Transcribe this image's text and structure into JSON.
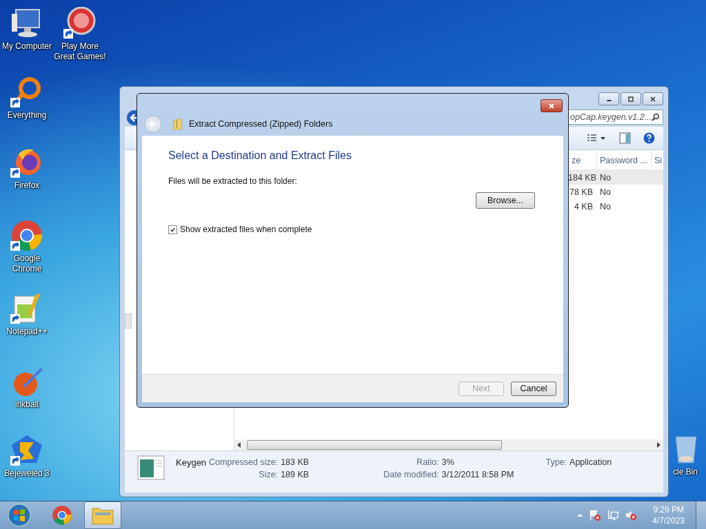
{
  "desktop_icons": [
    {
      "kind": "computer",
      "label": "My Computer",
      "shortcut": false
    },
    {
      "kind": "popcap",
      "label": "Play More Great Games!",
      "shortcut": true
    },
    {
      "kind": "everything",
      "label": "Everything",
      "shortcut": true
    },
    {
      "kind": "firefox",
      "label": "Firefox",
      "shortcut": true
    },
    {
      "kind": "chrome",
      "label": "Google Chrome",
      "shortcut": true
    },
    {
      "kind": "notepad",
      "label": "Notepad++",
      "shortcut": true
    },
    {
      "kind": "inkball",
      "label": "inkball",
      "shortcut": false
    },
    {
      "kind": "bejeweled",
      "label": "Bejeweled 3",
      "shortcut": true
    },
    {
      "kind": "recycle",
      "label": "cle Bin",
      "shortcut": false
    }
  ],
  "explorer": {
    "search": "opCap.keygen.v1.2...",
    "columns": [
      "ze",
      "Password ...",
      "Si"
    ],
    "rows": [
      {
        "cells": [
          "184 KB",
          "No"
        ],
        "selected": true
      },
      {
        "cells": [
          "78 KB",
          "No"
        ],
        "selected": false
      },
      {
        "cells": [
          "4 KB",
          "No"
        ],
        "selected": false
      }
    ],
    "details": {
      "name": "Keygen",
      "fields": [
        {
          "label": "Compressed size:",
          "value": "183 KB"
        },
        {
          "label": "Size:",
          "value": "189 KB"
        },
        {
          "label": "Ratio:",
          "value": "3%"
        },
        {
          "label": "Date modified:",
          "value": "3/12/2011 8:58 PM"
        },
        {
          "label": "Type:",
          "value": "Application"
        }
      ]
    }
  },
  "dialog": {
    "title": "Extract Compressed (Zipped) Folders",
    "heading": "Select a Destination and Extract Files",
    "folder_label": "Files will be extracted to this folder:",
    "browse": "Browse...",
    "show_files": {
      "label": "Show extracted files when complete",
      "checked": true
    },
    "buttons": [
      {
        "label": "Next",
        "disabled": true
      },
      {
        "label": "Cancel",
        "disabled": false
      }
    ]
  },
  "taskbar": {
    "items": [
      {
        "kind": "chrome",
        "active": false
      },
      {
        "kind": "folder",
        "active": true
      }
    ],
    "clock": {
      "time": "9:29 PM",
      "date": "4/7/2023"
    }
  }
}
